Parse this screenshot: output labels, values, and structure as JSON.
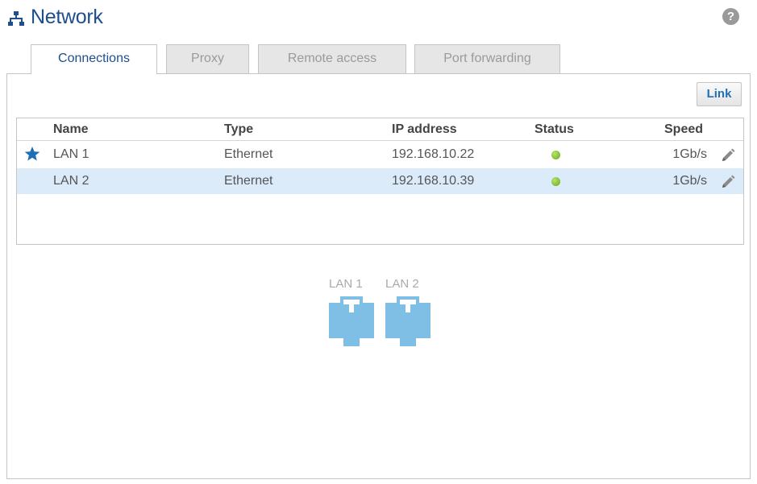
{
  "header": {
    "title": "Network",
    "icon": "network-icon",
    "help_label": "?"
  },
  "tabs": [
    {
      "label": "Connections",
      "active": true
    },
    {
      "label": "Proxy",
      "active": false
    },
    {
      "label": "Remote access",
      "active": false
    },
    {
      "label": "Port forwarding",
      "active": false
    }
  ],
  "toolbar": {
    "link_label": "Link"
  },
  "table": {
    "columns": [
      "Name",
      "Type",
      "IP address",
      "Status",
      "Speed"
    ],
    "rows": [
      {
        "name": "LAN 1",
        "type": "Ethernet",
        "ip": "192.168.10.22",
        "status": "connected",
        "speed": "1Gb/s",
        "primary": true,
        "selected": false
      },
      {
        "name": "LAN 2",
        "type": "Ethernet",
        "ip": "192.168.10.39",
        "status": "connected",
        "speed": "1Gb/s",
        "primary": false,
        "selected": true
      }
    ]
  },
  "ports": [
    {
      "label": "LAN 1",
      "icon": "ethernet-port-icon"
    },
    {
      "label": "LAN 2",
      "icon": "ethernet-port-icon"
    }
  ],
  "colors": {
    "accent": "#1f4e8c",
    "link": "#1f6fb5",
    "selected_row": "#dcebfa",
    "status_ok": "#7dbb2d",
    "port": "#7fbfe6",
    "star": "#1f6fb5"
  }
}
